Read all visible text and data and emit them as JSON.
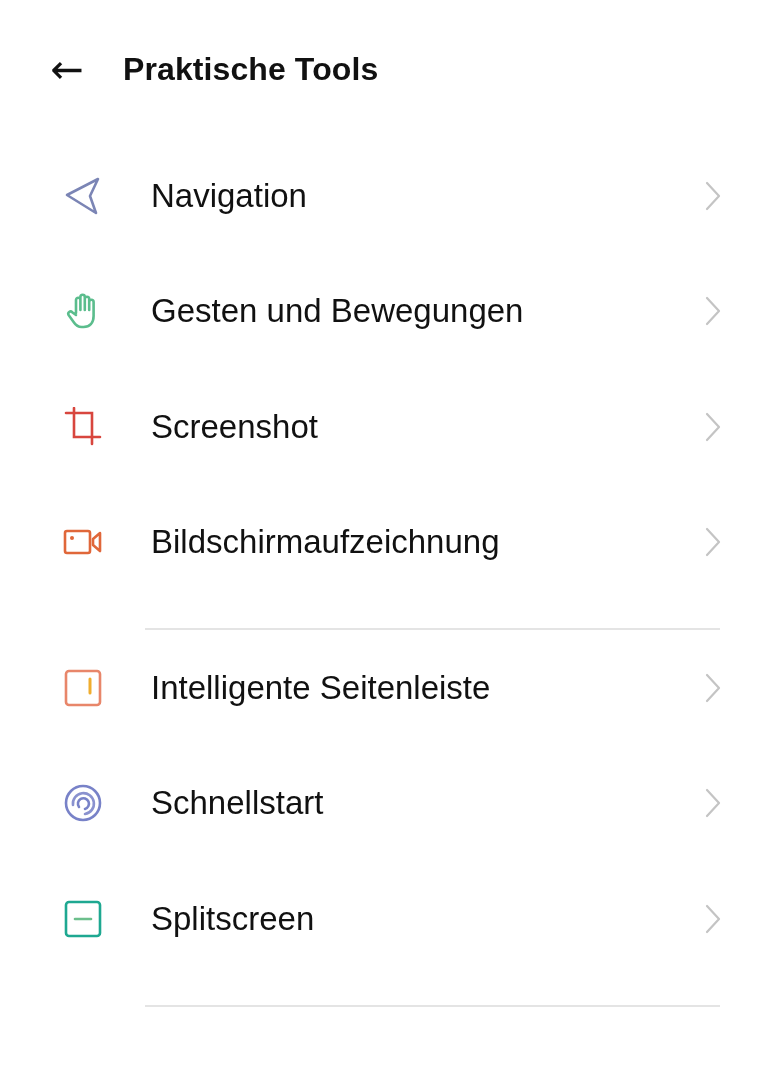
{
  "header": {
    "back": "←",
    "title": "Praktische Tools"
  },
  "groups": [
    {
      "items": [
        {
          "label": "Navigation"
        },
        {
          "label": "Gesten und Bewegungen"
        },
        {
          "label": "Screenshot"
        },
        {
          "label": "Bildschirmaufzeichnung"
        }
      ]
    },
    {
      "items": [
        {
          "label": "Intelligente Seitenleiste"
        },
        {
          "label": "Schnellstart"
        },
        {
          "label": "Splitscreen"
        }
      ]
    }
  ]
}
